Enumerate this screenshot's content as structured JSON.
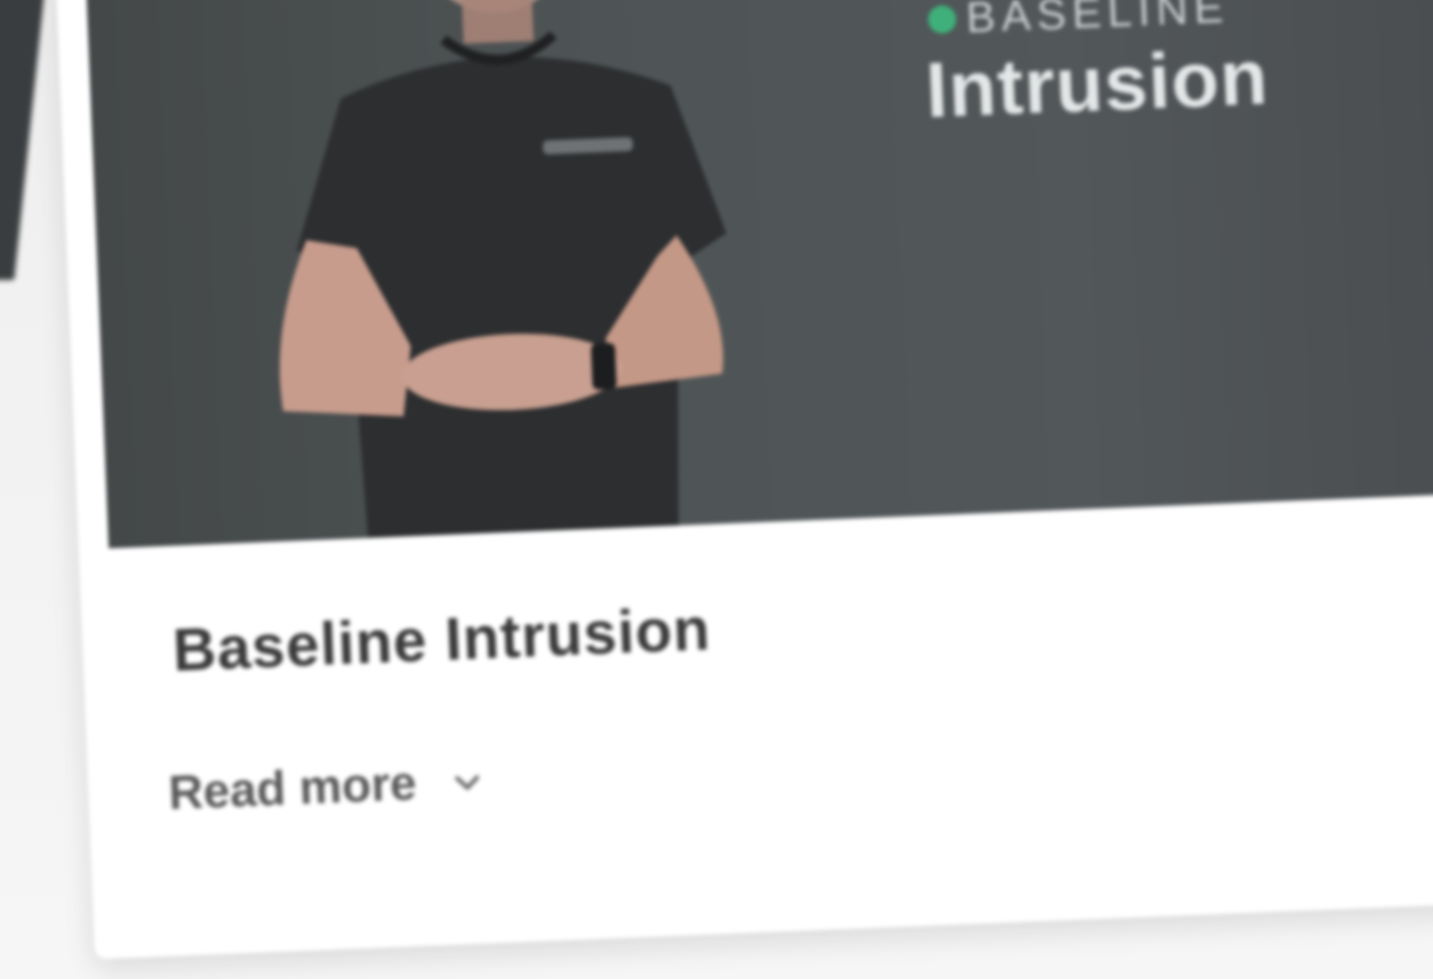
{
  "hero": {
    "brand": "BASELINE",
    "title": "Intrusion"
  },
  "card": {
    "title": "Baseline Intrusion",
    "read_more": "Read more"
  },
  "icons": {
    "brand": "baseline-logo-icon",
    "expand": "chevron-down-icon"
  },
  "colors": {
    "accent": "#3fb07a",
    "hero_background": "#4b4f51",
    "card_background": "#ffffff",
    "title_text": "#3a3a3a"
  }
}
